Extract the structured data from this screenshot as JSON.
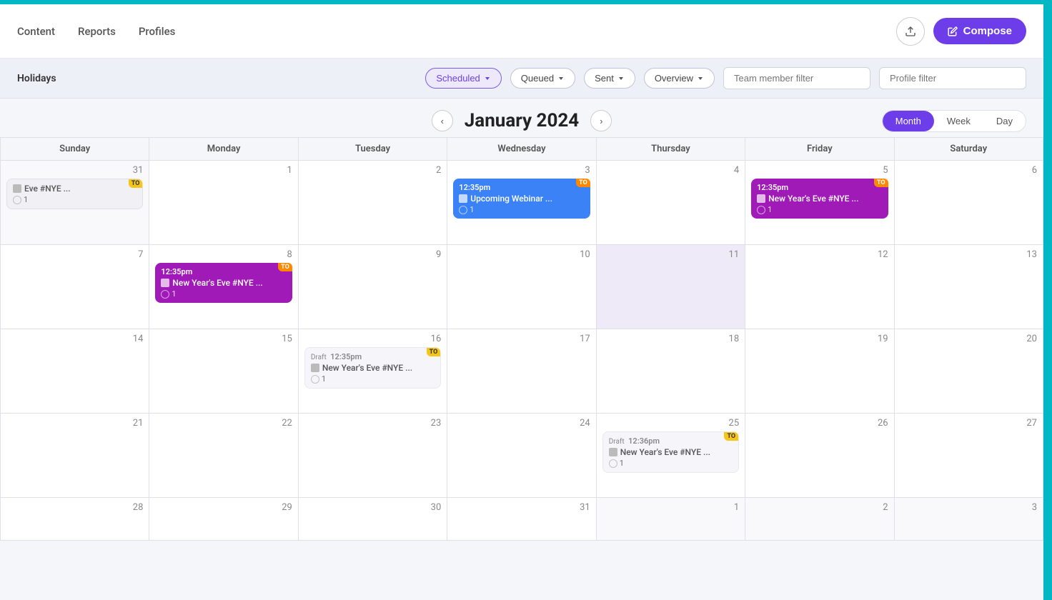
{
  "topBar": {
    "teal_color": "#00b8c4"
  },
  "nav": {
    "links": [
      "Content",
      "Reports",
      "Profiles"
    ],
    "upload_label": "↑",
    "compose_label": "✏ Compose"
  },
  "filterBar": {
    "holidays_label": "Holidays",
    "scheduled_label": "Scheduled",
    "queued_label": "Queued",
    "sent_label": "Sent",
    "overview_label": "Overview",
    "team_member_placeholder": "Team member filter",
    "profile_placeholder": "Profile filter"
  },
  "calendar": {
    "month_title": "January 2024",
    "prev_label": "‹",
    "next_label": "›",
    "views": [
      "Month",
      "Week",
      "Day"
    ],
    "active_view": "Month",
    "headers": [
      "Sunday",
      "Monday",
      "Tuesday",
      "Wednesday",
      "Thursday",
      "Friday",
      "Saturday"
    ],
    "weeks": [
      [
        {
          "day": 31,
          "other": true,
          "events": [
            {
              "type": "gray",
              "time": "",
              "title": "Eve #NYE ...",
              "count": "1",
              "to": true
            }
          ]
        },
        {
          "day": 1,
          "events": []
        },
        {
          "day": 2,
          "events": []
        },
        {
          "day": 3,
          "events": [
            {
              "type": "blue",
              "time": "12:35pm",
              "title": "Upcoming Webinar ...",
              "count": "1",
              "to": true
            }
          ]
        },
        {
          "day": 4,
          "events": []
        },
        {
          "day": 5,
          "events": [
            {
              "type": "purple",
              "time": "12:35pm",
              "title": "New Year's Eve #NYE ...",
              "count": "1",
              "to": true
            }
          ]
        },
        {
          "day": 6,
          "events": []
        }
      ],
      [
        {
          "day": 7,
          "events": []
        },
        {
          "day": 8,
          "events": [
            {
              "type": "purple",
              "time": "12:35pm",
              "title": "New Year's Eve #NYE ...",
              "count": "1",
              "to": true
            }
          ]
        },
        {
          "day": 9,
          "events": []
        },
        {
          "day": 10,
          "events": []
        },
        {
          "day": 11,
          "highlight": true,
          "events": []
        },
        {
          "day": 12,
          "events": []
        },
        {
          "day": 13,
          "events": []
        }
      ],
      [
        {
          "day": 14,
          "events": []
        },
        {
          "day": 15,
          "events": []
        },
        {
          "day": 16,
          "events": [
            {
              "type": "gray",
              "time": "12:35pm",
              "draft": true,
              "title": "New Year's Eve #NYE ...",
              "count": "1",
              "to": true
            }
          ]
        },
        {
          "day": 17,
          "events": []
        },
        {
          "day": 18,
          "events": []
        },
        {
          "day": 19,
          "events": []
        },
        {
          "day": 20,
          "events": []
        }
      ],
      [
        {
          "day": 21,
          "events": []
        },
        {
          "day": 22,
          "events": []
        },
        {
          "day": 23,
          "events": []
        },
        {
          "day": 24,
          "events": []
        },
        {
          "day": 25,
          "events": [
            {
              "type": "gray",
              "time": "12:36pm",
              "draft": true,
              "title": "New Year's Eve #NYE ...",
              "count": "1",
              "to": true
            }
          ]
        },
        {
          "day": 26,
          "events": []
        },
        {
          "day": 27,
          "events": []
        }
      ],
      [
        {
          "day": 28,
          "events": []
        },
        {
          "day": 29,
          "events": []
        },
        {
          "day": 30,
          "events": []
        },
        {
          "day": 31,
          "events": []
        },
        {
          "day": 1,
          "other": true,
          "events": []
        },
        {
          "day": 2,
          "other": true,
          "events": []
        },
        {
          "day": 3,
          "other": true,
          "events": []
        }
      ]
    ]
  }
}
